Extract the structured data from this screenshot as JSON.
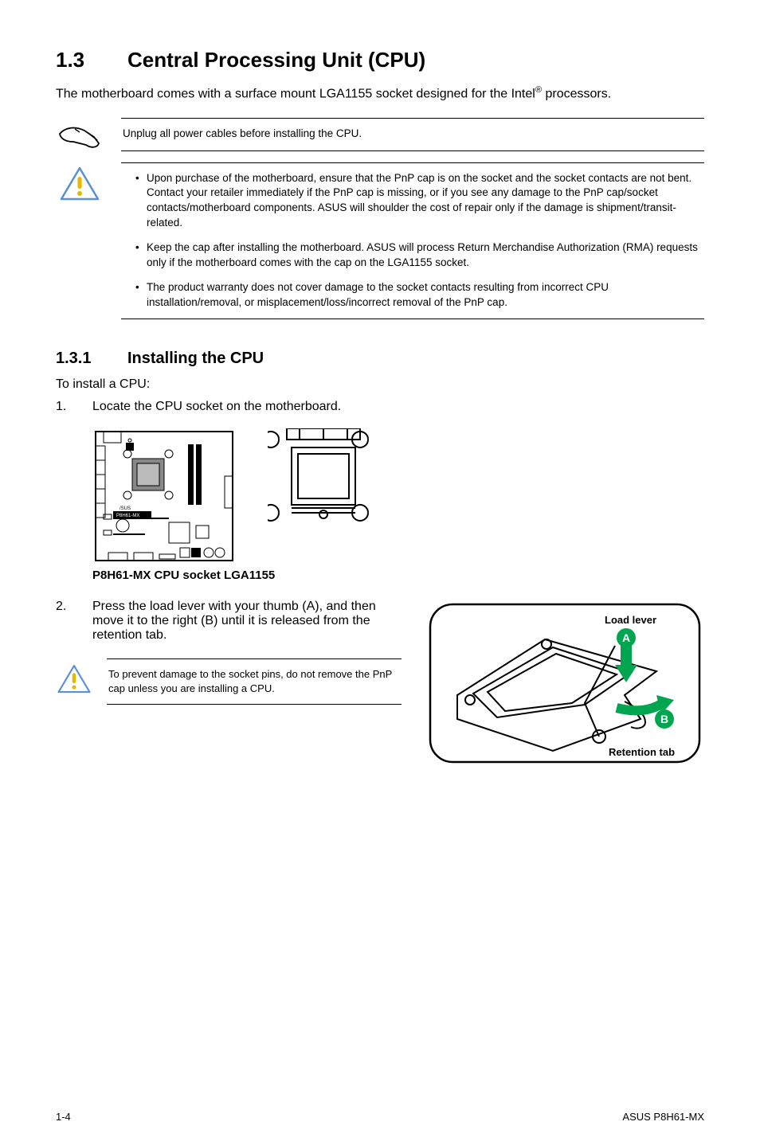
{
  "section": {
    "number": "1.3",
    "title": "Central Processing Unit (CPU)"
  },
  "intro": {
    "pre": "The motherboard comes with a surface mount LGA1155 socket designed for the Intel",
    "sup": "®",
    "post": " processors."
  },
  "note1": {
    "text": "Unplug all power cables before installing the CPU."
  },
  "note2": {
    "items": [
      "Upon purchase of the motherboard, ensure that the PnP cap is on the socket and the socket contacts are not bent. Contact your retailer immediately if the PnP cap is missing, or if you see any damage to the PnP cap/socket contacts/motherboard components. ASUS will shoulder the cost of repair only if the damage is shipment/transit-related.",
      "Keep the cap after installing the motherboard. ASUS will process Return Merchandise Authorization (RMA) requests only if the motherboard comes with the cap on the LGA1155 socket.",
      "The product warranty does not cover damage to the socket contacts resulting from incorrect CPU installation/removal, or misplacement/loss/incorrect removal of the PnP cap."
    ]
  },
  "subsection": {
    "number": "1.3.1",
    "title": "Installing the CPU"
  },
  "install_intro": "To install a CPU:",
  "step1": {
    "num": "1.",
    "text": "Locate the CPU socket on the motherboard."
  },
  "board_label": "P8H61-MX",
  "caption1": "P8H61-MX CPU socket LGA1155",
  "step2": {
    "num": "2.",
    "text": "Press the load lever with your thumb (A), and then move it to the right (B) until it is released from the retention tab."
  },
  "mini_note": "To prevent damage to the socket pins, do not remove the PnP cap unless you are installing a CPU.",
  "load_lever_label": "Load lever",
  "retention_tab_label": "Retention tab",
  "marker_a": "A",
  "marker_b": "B",
  "footer": {
    "left": "1-4",
    "right": "ASUS P8H61-MX"
  }
}
